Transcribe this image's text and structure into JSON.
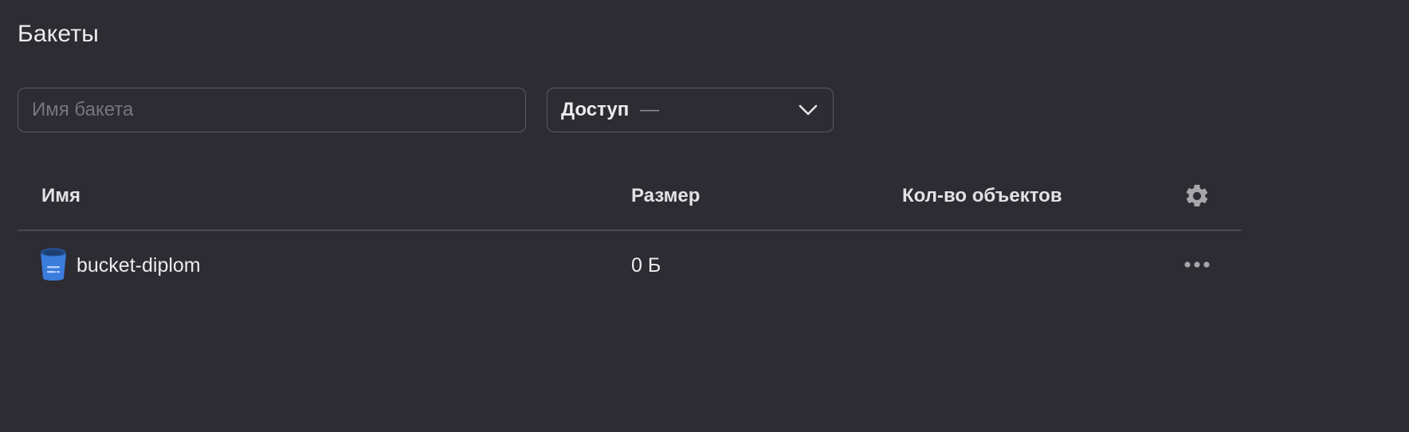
{
  "page": {
    "title": "Бакеты"
  },
  "filters": {
    "search_placeholder": "Имя бакета",
    "search_value": "",
    "access_label": "Доступ",
    "access_value": "—"
  },
  "table": {
    "columns": {
      "name": "Имя",
      "size": "Размер",
      "objects_count": "Кол-во объектов"
    },
    "rows": [
      {
        "name": "bucket-diplom",
        "size": "0 Б",
        "objects_count": "",
        "icon": "bucket-icon"
      }
    ]
  },
  "icons": {
    "access_dropdown": "chevron-down-icon",
    "column_settings": "gear-icon",
    "row_actions": "more-horizontal-icon",
    "row_type": "bucket-icon"
  },
  "colors": {
    "background": "#2d2c33",
    "border": "#5b5a61",
    "divider": "#4a4950",
    "text": "#ececee",
    "muted": "#8a898f",
    "icon": "#a7a6ab",
    "bucket_blue": "#3b7ddd"
  }
}
